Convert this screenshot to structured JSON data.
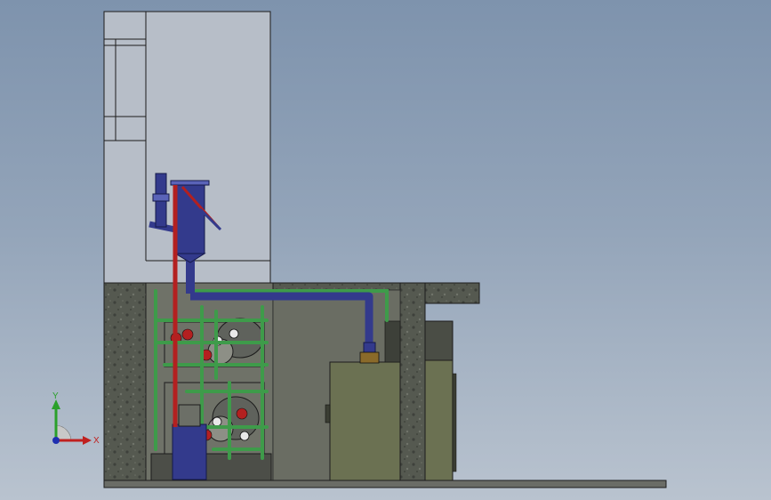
{
  "viewport": {
    "background_top": "#7e93ad",
    "background_bottom": "#b9c3cf"
  },
  "colors": {
    "tank_fill": "#b7bec8",
    "foundation": "#5d615a",
    "concrete_dark": "#3e413b",
    "floor_slab": "#6a6c66",
    "pipe_blue": "#333a8c",
    "pipe_blue_light": "#5a63b8",
    "pipe_green": "#3e9b4a",
    "pipe_red": "#b32020",
    "cabinet": "#6b7152",
    "equipment_dark": "#2f322d"
  },
  "triad": {
    "x_label": "X",
    "y_label": "Y",
    "x_color": "#c0201f",
    "y_color": "#2aa02a",
    "z_color": "#1f2fb0"
  }
}
